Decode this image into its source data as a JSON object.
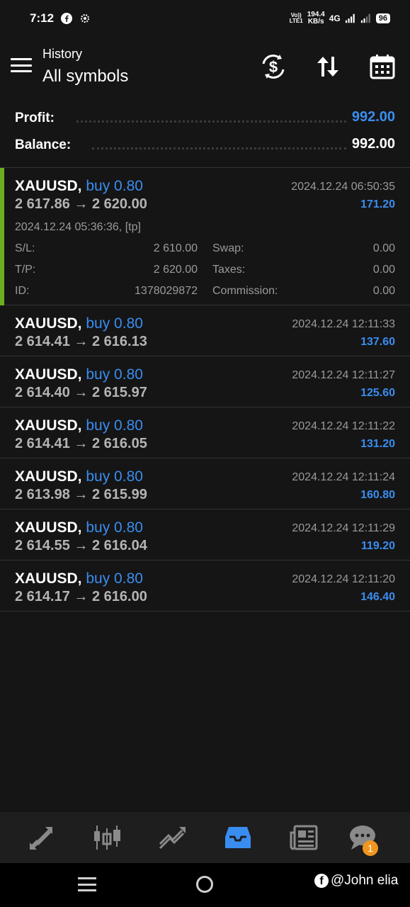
{
  "status_bar": {
    "time": "7:12",
    "volte_top": "Vo))",
    "volte_bottom": "LTE1",
    "speed_value": "194.4",
    "speed_unit": "KB/s",
    "network": "4G",
    "battery": "96"
  },
  "header": {
    "subtitle": "History",
    "title": "All symbols"
  },
  "summary": {
    "profit_label": "Profit:",
    "profit_value": "992.00",
    "balance_label": "Balance:",
    "balance_value": "992.00"
  },
  "deals": [
    {
      "symbol": "XAUUSD,",
      "direction": "buy 0.80",
      "prices": "2 617.86 → 2 620.00",
      "close_time": "2024.12.24 06:50:35",
      "profit": "171.20",
      "expanded": true,
      "open_info": "2024.12.24 05:36:36, [tp]",
      "sl_label": "S/L:",
      "sl_value": "2 610.00",
      "tp_label": "T/P:",
      "tp_value": "2 620.00",
      "id_label": "ID:",
      "id_value": "1378029872",
      "swap_label": "Swap:",
      "swap_value": "0.00",
      "taxes_label": "Taxes:",
      "taxes_value": "0.00",
      "commission_label": "Commission:",
      "commission_value": "0.00"
    },
    {
      "symbol": "XAUUSD,",
      "direction": "buy 0.80",
      "prices": "2 614.41 → 2 616.13",
      "close_time": "2024.12.24 12:11:33",
      "profit": "137.60"
    },
    {
      "symbol": "XAUUSD,",
      "direction": "buy 0.80",
      "prices": "2 614.40 → 2 615.97",
      "close_time": "2024.12.24 12:11:27",
      "profit": "125.60"
    },
    {
      "symbol": "XAUUSD,",
      "direction": "buy 0.80",
      "prices": "2 614.41 → 2 616.05",
      "close_time": "2024.12.24 12:11:22",
      "profit": "131.20"
    },
    {
      "symbol": "XAUUSD,",
      "direction": "buy 0.80",
      "prices": "2 613.98 → 2 615.99",
      "close_time": "2024.12.24 12:11:24",
      "profit": "160.80"
    },
    {
      "symbol": "XAUUSD,",
      "direction": "buy 0.80",
      "prices": "2 614.55 → 2 616.04",
      "close_time": "2024.12.24 12:11:29",
      "profit": "119.20"
    },
    {
      "symbol": "XAUUSD,",
      "direction": "buy 0.80",
      "prices": "2 614.17 → 2 616.00",
      "close_time": "2024.12.24 12:11:20",
      "profit": "146.40"
    }
  ],
  "bottom_nav": {
    "items": [
      "quotes-icon",
      "chart-icon",
      "trade-icon",
      "history-icon",
      "news-icon",
      "messages-icon"
    ],
    "active": "history-icon",
    "messages_badge": "1"
  },
  "colors": {
    "accent_blue": "#3a8df0",
    "accent_green": "#6ab01e",
    "badge_orange": "#f0961e",
    "background": "#151515"
  },
  "watermark": {
    "text": "@John elia"
  }
}
